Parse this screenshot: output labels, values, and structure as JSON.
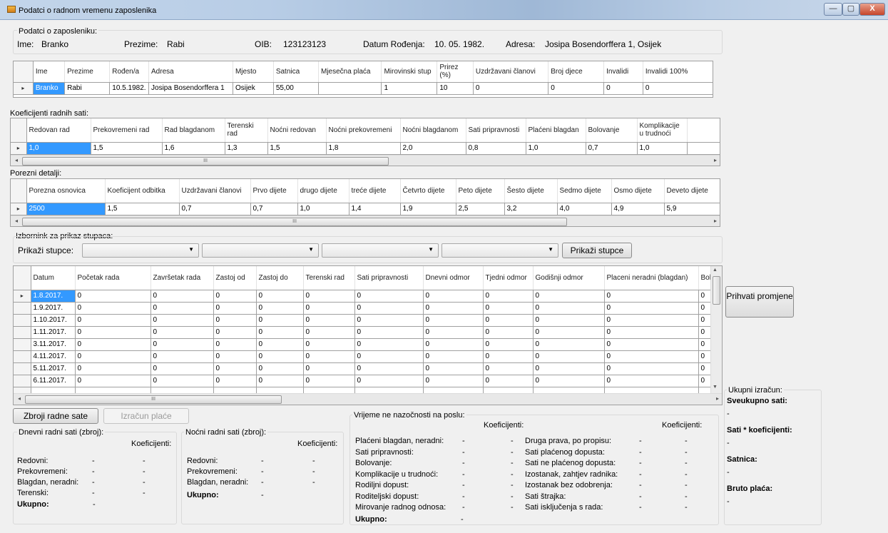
{
  "window": {
    "title": "Podatci o radnom vremenu zaposlenika",
    "min": "—",
    "max": "▢",
    "close": "X"
  },
  "employee": {
    "group_label": "Podatci o zaposleniku:",
    "ime_label": "Ime:",
    "ime": "Branko",
    "prezime_label": "Prezime:",
    "prezime": "Rabi",
    "oib_label": "OIB:",
    "oib": "123123123",
    "datum_label": "Datum Rođenja:",
    "datum": "10. 05. 1982.",
    "adresa_label": "Adresa:",
    "adresa": "Josipa Bosendorffera 1, Osijek"
  },
  "grid1": {
    "columns": [
      "Ime",
      "Prezime",
      "Rođen/a",
      "Adresa",
      "Mjesto",
      "Satnica",
      "Mjesečna plaća",
      "Mirovinski stup",
      "Prirez (%)",
      "Uzdržavani članovi",
      "Broj djece",
      "Invalidi",
      "Invalidi 100%"
    ],
    "row": [
      "Branko",
      "Rabi",
      "10.5.1982.",
      "Josipa Bosendorffera 1",
      "Osijek",
      "55,00",
      "",
      "1",
      "10",
      "0",
      "0",
      "0",
      "0"
    ]
  },
  "koef": {
    "label": "Koeficijenti radnih sati:",
    "columns": [
      "Redovan rad",
      "Prekovremeni rad",
      "Rad blagdanom",
      "Terenski rad",
      "Noćni redovan",
      "Noćni prekovremeni",
      "Noćni blagdanom",
      "Sati pripravnosti",
      "Plaćeni blagdan",
      "Bolovanje",
      "Komplikacije u trudnoći"
    ],
    "row": [
      "1,0",
      "1,5",
      "1,6",
      "1,3",
      "1,5",
      "1,8",
      "2,0",
      "0,8",
      "1,0",
      "0,7",
      "1,0"
    ]
  },
  "porez": {
    "label": "Porezni detalji:",
    "columns": [
      "Porezna osnovica",
      "Koeficijent odbitka",
      "Uzdržavani članovi",
      "Prvo dijete",
      "drugo dijete",
      "treće dijete",
      "Četvrto dijete",
      "Peto dijete",
      "Šesto dijete",
      "Sedmo dijete",
      "Osmo dijete",
      "Deveto dijete"
    ],
    "row": [
      "2500",
      "1,5",
      "0,7",
      "0,7",
      "1,0",
      "1,4",
      "1,9",
      "2,5",
      "3,2",
      "4,0",
      "4,9",
      "5,9"
    ]
  },
  "izbornik": {
    "label": "Izbornink za prikaz stupaca:",
    "prikazi_label": "Prikaži stupce:",
    "button": "Prikaži stupce"
  },
  "hours": {
    "columns": [
      "Datum",
      "Početak rada",
      "Završetak rada",
      "Zastoj od",
      "Zastoj do",
      "Terenski rad",
      "Sati pripravnosti",
      "Dnevni odmor",
      "Tjedni odmor",
      "Godišnji odmor",
      "Placeni neradni (blagdan)",
      "Bolovan"
    ],
    "rows": [
      [
        "1.8.2017.",
        "0",
        "0",
        "0",
        "0",
        "0",
        "0",
        "0",
        "0",
        "0",
        "0",
        "0"
      ],
      [
        "1.9.2017.",
        "0",
        "0",
        "0",
        "0",
        "0",
        "0",
        "0",
        "0",
        "0",
        "0",
        "0"
      ],
      [
        "1.10.2017.",
        "0",
        "0",
        "0",
        "0",
        "0",
        "0",
        "0",
        "0",
        "0",
        "0",
        "0"
      ],
      [
        "1.11.2017.",
        "0",
        "0",
        "0",
        "0",
        "0",
        "0",
        "0",
        "0",
        "0",
        "0",
        "0"
      ],
      [
        "3.11.2017.",
        "0",
        "0",
        "0",
        "0",
        "0",
        "0",
        "0",
        "0",
        "0",
        "0",
        "0"
      ],
      [
        "4.11.2017.",
        "0",
        "0",
        "0",
        "0",
        "0",
        "0",
        "0",
        "0",
        "0",
        "0",
        "0"
      ],
      [
        "5.11.2017.",
        "0",
        "0",
        "0",
        "0",
        "0",
        "0",
        "0",
        "0",
        "0",
        "0",
        "0"
      ],
      [
        "6.11.2017.",
        "0",
        "0",
        "0",
        "0",
        "0",
        "0",
        "0",
        "0",
        "0",
        "0",
        "0"
      ]
    ]
  },
  "prihvati": "Prihvati promjene",
  "buttons": {
    "zbroji": "Zbroji radne sate",
    "izracun": "Izračun plaće"
  },
  "dnevni": {
    "title": "Dnevni radni sati (zbroj):",
    "koef": "Koeficijenti:",
    "rows": [
      [
        "Redovni:",
        "-",
        "-"
      ],
      [
        "Prekovremeni:",
        "-",
        "-"
      ],
      [
        "Blagdan, neradni:",
        "-",
        "-"
      ],
      [
        "Terenski:",
        "-",
        "-"
      ]
    ],
    "total_label": "Ukupno:",
    "total": "-"
  },
  "nocni": {
    "title": "Noćni radni sati (zbroj):",
    "koef": "Koeficijenti:",
    "rows": [
      [
        "Redovni:",
        "-",
        "-"
      ],
      [
        "Prekovremeni:",
        "-",
        "-"
      ],
      [
        "Blagdan, neradni:",
        "-",
        "-"
      ]
    ],
    "total_label": "Ukupno:",
    "total": "-"
  },
  "odsutnost": {
    "title": "Vrijeme ne nazočnosti na poslu:",
    "koef1": "Koeficijenti:",
    "koef2": "Koeficijenti:",
    "left": [
      [
        "Plaćeni blagdan, neradni:",
        "-",
        "-"
      ],
      [
        "Sati pripravnosti:",
        "-",
        "-"
      ],
      [
        "Bolovanje:",
        "-",
        "-"
      ],
      [
        "Komplikacije u trudnoći:",
        "-",
        "-"
      ],
      [
        "Rodiljni dopust:",
        "-",
        "-"
      ],
      [
        "Roditeljski dopust:",
        "-",
        "-"
      ],
      [
        "Mirovanje radnog odnosa:",
        "-",
        "-"
      ]
    ],
    "right": [
      [
        "Druga prava, po propisu:",
        "-",
        "-"
      ],
      [
        "Sati plaćenog dopusta:",
        "-",
        "-"
      ],
      [
        "Sati ne plaćenog dopusta:",
        "-",
        "-"
      ],
      [
        "Izostanak, zahtjev radnika:",
        "-",
        "-"
      ],
      [
        "Izostanak bez odobrenja:",
        "-",
        "-"
      ],
      [
        "Sati štrajka:",
        "-",
        "-"
      ],
      [
        "Sati isključenja s rada:",
        "-",
        "-"
      ]
    ],
    "total_label": "Ukupno:",
    "total": "-"
  },
  "ukupni": {
    "title": "Ukupni izračun:",
    "items": [
      [
        "Sveukupno sati:",
        "-"
      ],
      [
        "Sati * koeficijenti:",
        "-"
      ],
      [
        "Satnica:",
        "-"
      ],
      [
        "Bruto plaća:",
        "-"
      ]
    ]
  },
  "scroll_glyph": "III"
}
